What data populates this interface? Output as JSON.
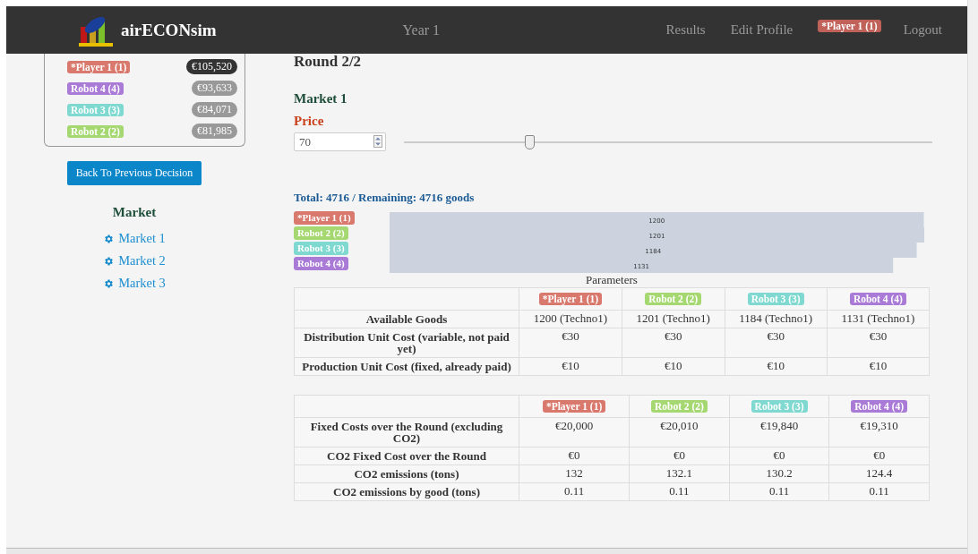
{
  "navbar": {
    "brand": "airECONsim",
    "center": "Year 1",
    "links": [
      "Results",
      "Edit Profile"
    ],
    "player_badge": {
      "label": "*Player 1 (1)",
      "color": "#c0625a"
    },
    "logout": "Logout"
  },
  "leaderboard": [
    {
      "label": "*Player 1 (1)",
      "color": "#d9786c",
      "amount": "€105,520",
      "current": true
    },
    {
      "label": "Robot 4 (4)",
      "color": "#a97ad6",
      "amount": "€93,633",
      "current": false
    },
    {
      "label": "Robot 3 (3)",
      "color": "#7fd9d0",
      "amount": "€84,071",
      "current": false
    },
    {
      "label": "Robot 2 (2)",
      "color": "#a6d872",
      "amount": "€81,985",
      "current": false
    }
  ],
  "back_button": "Back To Previous Decision",
  "sidebar": {
    "heading": "Market",
    "items": [
      "Market 1",
      "Market 2",
      "Market 3"
    ]
  },
  "main": {
    "round_title": "Round 2/2",
    "market_title": "Market 1",
    "price_label": "Price",
    "price_value": "70",
    "price_slider": {
      "level": 0.237
    },
    "total_text": "Total: 4716 / Remaining: 4716 goods",
    "chart": {
      "category_badges": [
        {
          "color": "#d9786c"
        },
        {
          "color": "#a6d872"
        },
        {
          "color": "#7fd9d0"
        },
        {
          "color": "#a97ad6"
        }
      ],
      "chart_data": {
        "type": "bar",
        "orientation": "horizontal",
        "categories": [
          "*Player 1 (1)",
          "Robot 2 (2)",
          "Robot 3 (3)",
          "Robot 4 (4)"
        ],
        "values": [
          1200,
          1201,
          1184,
          1131
        ],
        "data_labels": true
      }
    },
    "tables": [
      {
        "title": "Parameters",
        "headers": [
          {
            "label": "*Player 1 (1)",
            "color": "#d9786c"
          },
          {
            "label": "Robot 2 (2)",
            "color": "#a6d872"
          },
          {
            "label": "Robot 3 (3)",
            "color": "#7fd9d0"
          },
          {
            "label": "Robot 4 (4)",
            "color": "#a97ad6"
          }
        ],
        "rows": [
          {
            "label": "Available Goods",
            "cells": [
              "1200 (Techno1)",
              "1201 (Techno1)",
              "1184 (Techno1)",
              "1131 (Techno1)"
            ]
          },
          {
            "label": "Distribution Unit Cost (variable, not paid yet)",
            "cells": [
              "€30",
              "€30",
              "€30",
              "€30"
            ]
          },
          {
            "label": "Production Unit Cost (fixed, already paid)",
            "cells": [
              "€10",
              "€10",
              "€10",
              "€10"
            ]
          }
        ]
      },
      {
        "headers": [
          {
            "label": "*Player 1 (1)",
            "color": "#d9786c"
          },
          {
            "label": "Robot 2 (2)",
            "color": "#a6d872"
          },
          {
            "label": "Robot 3 (3)",
            "color": "#7fd9d0"
          },
          {
            "label": "Robot 4 (4)",
            "color": "#a97ad6"
          }
        ],
        "rows": [
          {
            "label": "Fixed Costs over the Round (excluding CO2)",
            "cells": [
              "€20,000",
              "€20,010",
              "€19,840",
              "€19,310"
            ]
          },
          {
            "label": "CO2 Fixed Cost over the Round",
            "cells": [
              "€0",
              "€0",
              "€0",
              "€0"
            ]
          },
          {
            "label": "CO2 emissions (tons)",
            "cells": [
              "132",
              "132.1",
              "130.2",
              "124.4"
            ]
          },
          {
            "label": "CO2 emissions by good (tons)",
            "cells": [
              "0.11",
              "0.11",
              "0.11",
              "0.11"
            ]
          }
        ]
      }
    ]
  }
}
